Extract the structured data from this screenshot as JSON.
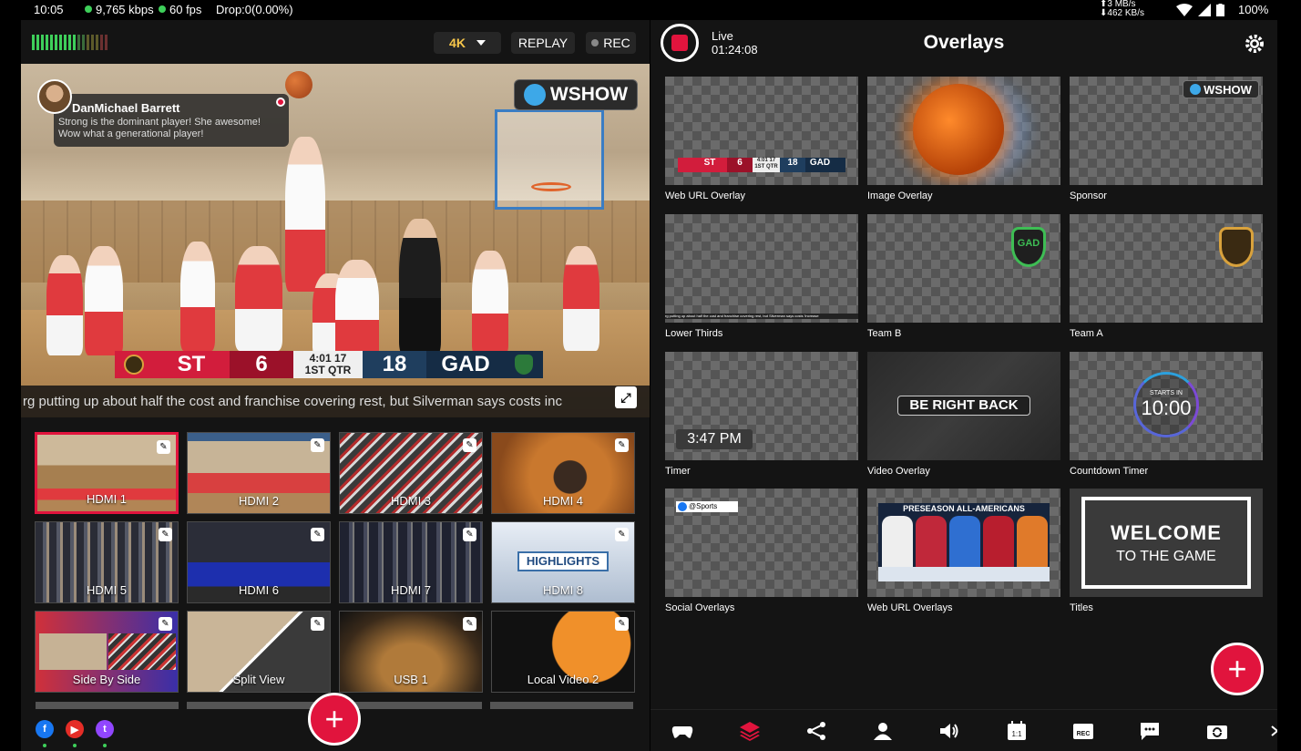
{
  "status_bar": {
    "time": "10:05",
    "bitrate": "9,765 kbps",
    "fps": "60 fps",
    "drop": "Drop:0(0.00%)",
    "net_up": "3 MB/s",
    "net_down": "462 KB/s",
    "battery": "100%"
  },
  "left_panel": {
    "toolbar": {
      "resolution": "4K",
      "replay_label": "REPLAY",
      "rec_label": "REC"
    },
    "chat": {
      "name": "DanMichael Barrett",
      "message": "Strong is the dominant player! She awesome! Wow what a generational player!"
    },
    "watermark": "WSHOW",
    "scoreboard": {
      "home_team": "ST",
      "home_score": "6",
      "clock": "4:01",
      "shot_clock": "17",
      "period": "1ST QTR",
      "away_score": "18",
      "away_team": "GAD"
    },
    "ticker": "rg putting up about half the cost and franchise covering rest, but Silverman says costs inc",
    "sources": [
      {
        "label": "HDMI 1",
        "active": true
      },
      {
        "label": "HDMI 2",
        "active": false
      },
      {
        "label": "HDMI 3",
        "active": false
      },
      {
        "label": "HDMI 4",
        "active": false
      },
      {
        "label": "HDMI 5",
        "active": false
      },
      {
        "label": "HDMI 6",
        "active": false
      },
      {
        "label": "HDMI 7",
        "active": false
      },
      {
        "label": "HDMI 8",
        "active": false
      },
      {
        "label": "Side By Side",
        "active": false
      },
      {
        "label": "Split View",
        "active": false
      },
      {
        "label": "USB 1",
        "active": false
      },
      {
        "label": "Local Video 2",
        "active": false
      }
    ],
    "hdmi8_overlay_text": "HIGHLIGHTS",
    "destinations": [
      "facebook-icon",
      "youtube-icon",
      "twitch-icon"
    ]
  },
  "right_panel": {
    "live_label": "Live",
    "live_time": "01:24:08",
    "title": "Overlays",
    "overlays": [
      {
        "caption": "Web URL Overlay"
      },
      {
        "caption": "Image Overlay"
      },
      {
        "caption": "Sponsor"
      },
      {
        "caption": "Lower Thirds"
      },
      {
        "caption": "Team B"
      },
      {
        "caption": "Team A"
      },
      {
        "caption": "Timer"
      },
      {
        "caption": "Video Overlay"
      },
      {
        "caption": "Countdown Timer"
      },
      {
        "caption": "Social Overlays"
      },
      {
        "caption": "Web URL Overlays"
      },
      {
        "caption": "Titles"
      }
    ],
    "tile_text": {
      "mini_home": "ST",
      "mini_home_score": "6",
      "mini_clock": "4:01 17",
      "mini_period": "1ST QTR",
      "mini_away_score": "18",
      "mini_away": "GAD",
      "sponsor": "WSHOW",
      "lower_third": "rg putting up about half the cost and franchise covering rest, but Silverman says costs 'increase",
      "team_b_logo": "GAD",
      "timer": "3:47 PM",
      "video_overlay": "BE RIGHT BACK",
      "countdown_label": "STARTS IN",
      "countdown_time": "10:00",
      "social_handle": "@Sports",
      "allam_title": "PRESEASON ALL-AMERICANS",
      "welcome_line1": "WELCOME",
      "welcome_line2": "TO THE GAME"
    },
    "nav_icons": [
      "gamepad-icon",
      "layers-icon",
      "share-icon",
      "guests-icon",
      "audio-icon",
      "aspect-ratio-icon",
      "rec-icon",
      "comments-icon",
      "switch-camera-icon"
    ]
  },
  "colors": {
    "accent": "#e1143d",
    "live_green": "#3ecf5a",
    "resolution_gold": "#f7c64a"
  }
}
